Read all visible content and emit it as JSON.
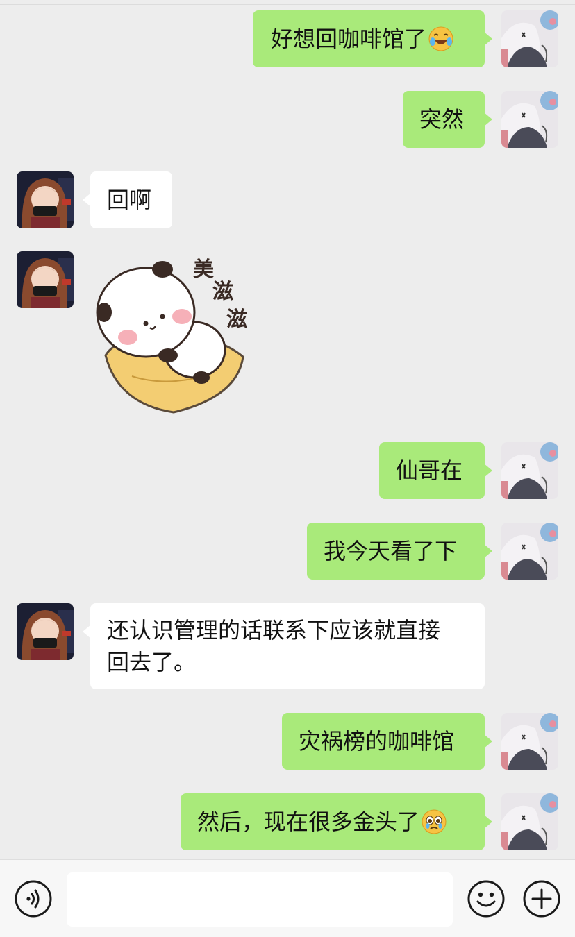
{
  "messages": [
    {
      "side": "out",
      "text": "好想回咖啡馆了",
      "emoji": "laughing-crying-emoji"
    },
    {
      "side": "out",
      "text": "突然"
    },
    {
      "side": "in",
      "text": "回啊"
    },
    {
      "side": "in",
      "sticker": {
        "name": "panda-sticker",
        "caption": [
          "美",
          "滋",
          "滋"
        ]
      }
    },
    {
      "side": "out",
      "text": "仙哥在"
    },
    {
      "side": "out",
      "text": "我今天看了下"
    },
    {
      "side": "in",
      "text_lines": [
        "还认识管理的话联系下应该就直接",
        "回去了。"
      ]
    },
    {
      "side": "out",
      "text": "灾祸榜的咖啡馆"
    },
    {
      "side": "out",
      "text": "然后，现在很多金头了",
      "emoji": "teary-eyed-emoji"
    }
  ],
  "input_bar": {
    "voice_icon": "voice-icon",
    "text_value": "",
    "emoji_icon": "smiley-icon",
    "more_icon": "plus-icon"
  },
  "colors": {
    "background": "#ededed",
    "outgoing_bubble": "#a9ea7a",
    "incoming_bubble": "#ffffff"
  }
}
